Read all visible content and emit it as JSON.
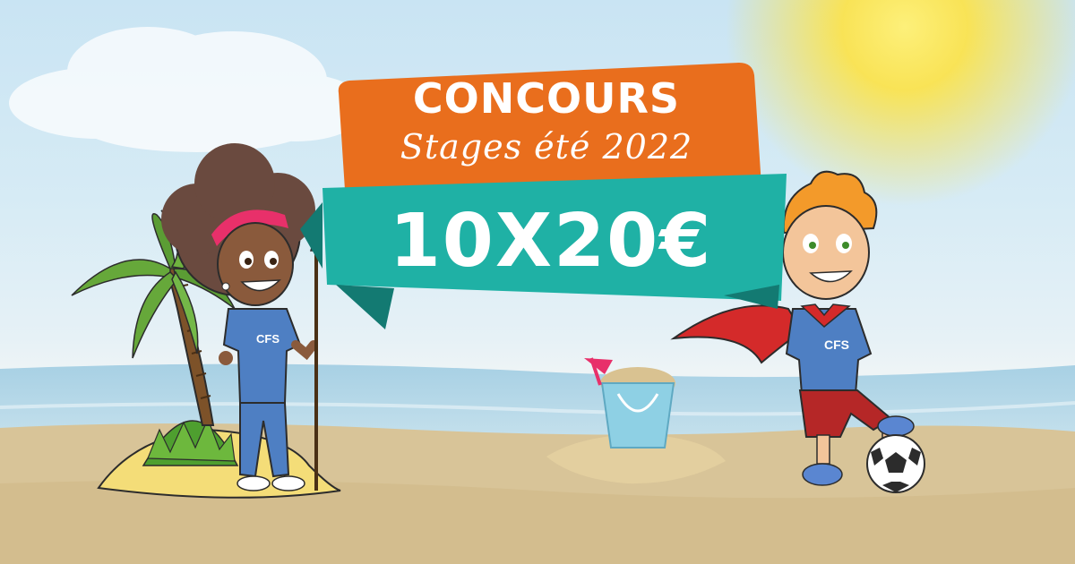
{
  "banner": {
    "title": "CONCOURS",
    "subtitle": "Stages été 2022",
    "prize": "10X20€"
  },
  "characters": {
    "girl_shirt_logo": "CFS",
    "boy_shirt_logo": "CFS"
  },
  "colors": {
    "sky": "#c9e4f3",
    "sea": "#b6d9ea",
    "sand": "#d8c498",
    "sun": "#fbe34e",
    "banner_orange": "#e96e1d",
    "banner_teal": "#1fb1a5",
    "shirt_blue": "#4e7fc3",
    "cape_red": "#d42a2a"
  },
  "icons": [
    "sun-icon",
    "cloud-icon",
    "palm-tree-icon",
    "sand-bucket-icon",
    "soccer-ball-icon"
  ]
}
